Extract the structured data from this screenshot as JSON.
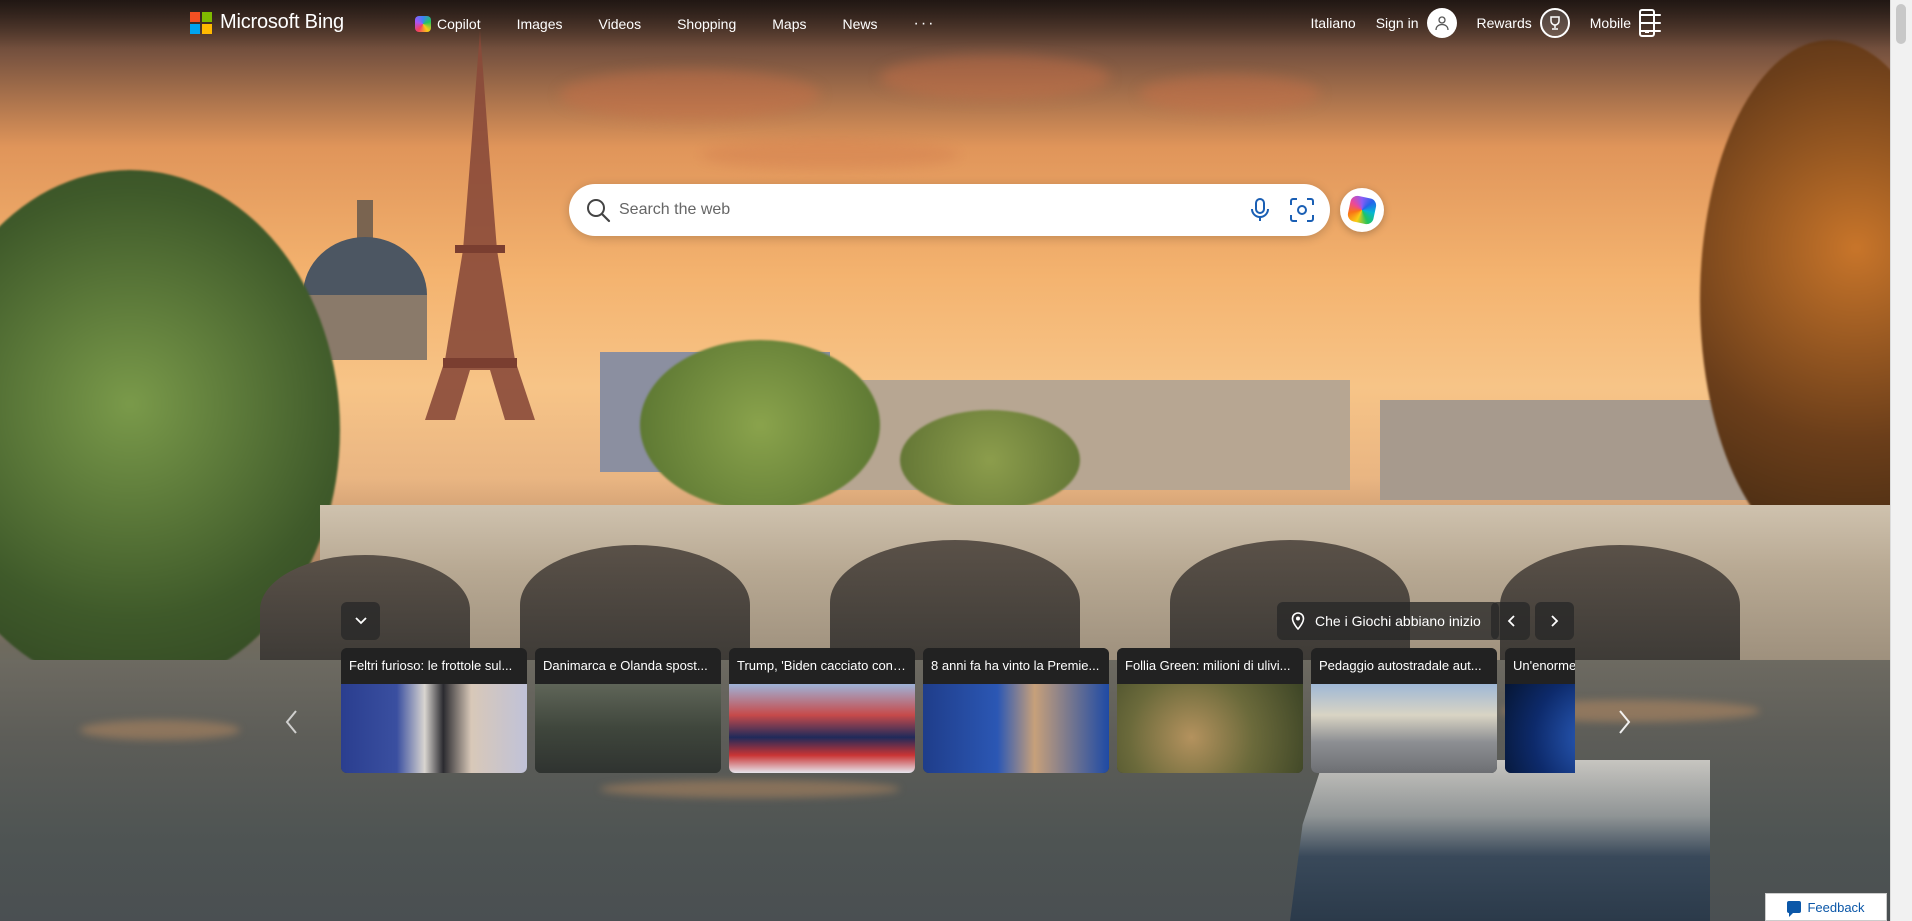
{
  "header": {
    "brand": "Microsoft Bing",
    "nav": [
      {
        "label": "Copilot",
        "icon": "copilot-icon"
      },
      {
        "label": "Images"
      },
      {
        "label": "Videos"
      },
      {
        "label": "Shopping"
      },
      {
        "label": "Maps"
      },
      {
        "label": "News"
      }
    ],
    "more_label": "···",
    "language": "Italiano",
    "sign_in": "Sign in",
    "rewards": "Rewards",
    "mobile": "Mobile"
  },
  "search": {
    "placeholder": "Search the web"
  },
  "carousel": {
    "location_label": "Che i Giochi abbiano inizio",
    "cards": [
      {
        "title": "Feltri furioso: le frottole sul..."
      },
      {
        "title": "Danimarca e Olanda spost..."
      },
      {
        "title": "Trump, 'Biden cacciato con ..."
      },
      {
        "title": "8 anni fa ha vinto la Premie..."
      },
      {
        "title": "Follia Green: milioni di ulivi..."
      },
      {
        "title": "Pedaggio autostradale aut..."
      },
      {
        "title": "Un'enorme"
      }
    ]
  },
  "feedback": {
    "label": "Feedback"
  },
  "colors": {
    "ms_red": "#f25022",
    "ms_green": "#7fba00",
    "ms_blue": "#00a4ef",
    "ms_yellow": "#ffb900",
    "feedback_blue": "#0b57a8"
  }
}
